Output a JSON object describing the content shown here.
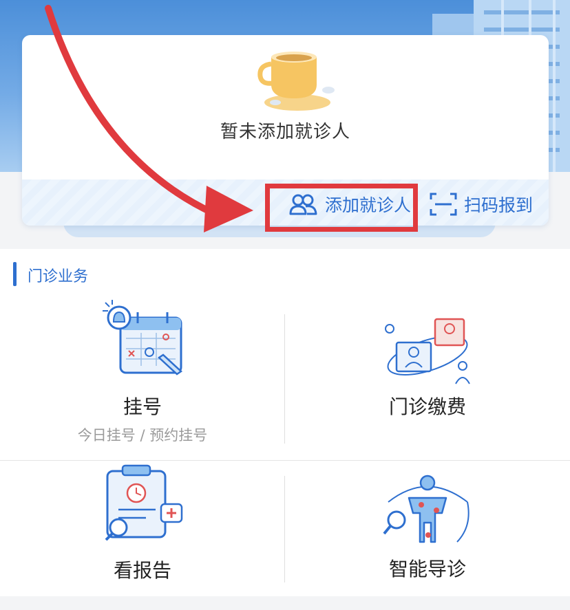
{
  "card": {
    "empty_text": "暂未添加就诊人",
    "add_patient_label": "添加就诊人",
    "scan_checkin_label": "扫码报到"
  },
  "section": {
    "title": "门诊业务"
  },
  "tiles": [
    {
      "label": "挂号",
      "sublabel": "今日挂号 / 预约挂号"
    },
    {
      "label": "门诊缴费"
    },
    {
      "label": "看报告"
    },
    {
      "label": "智能导诊"
    }
  ],
  "colors": {
    "accent": "#2e6fcf",
    "highlight": "#e03a3e",
    "hero_blue": "#4c8fd9"
  }
}
